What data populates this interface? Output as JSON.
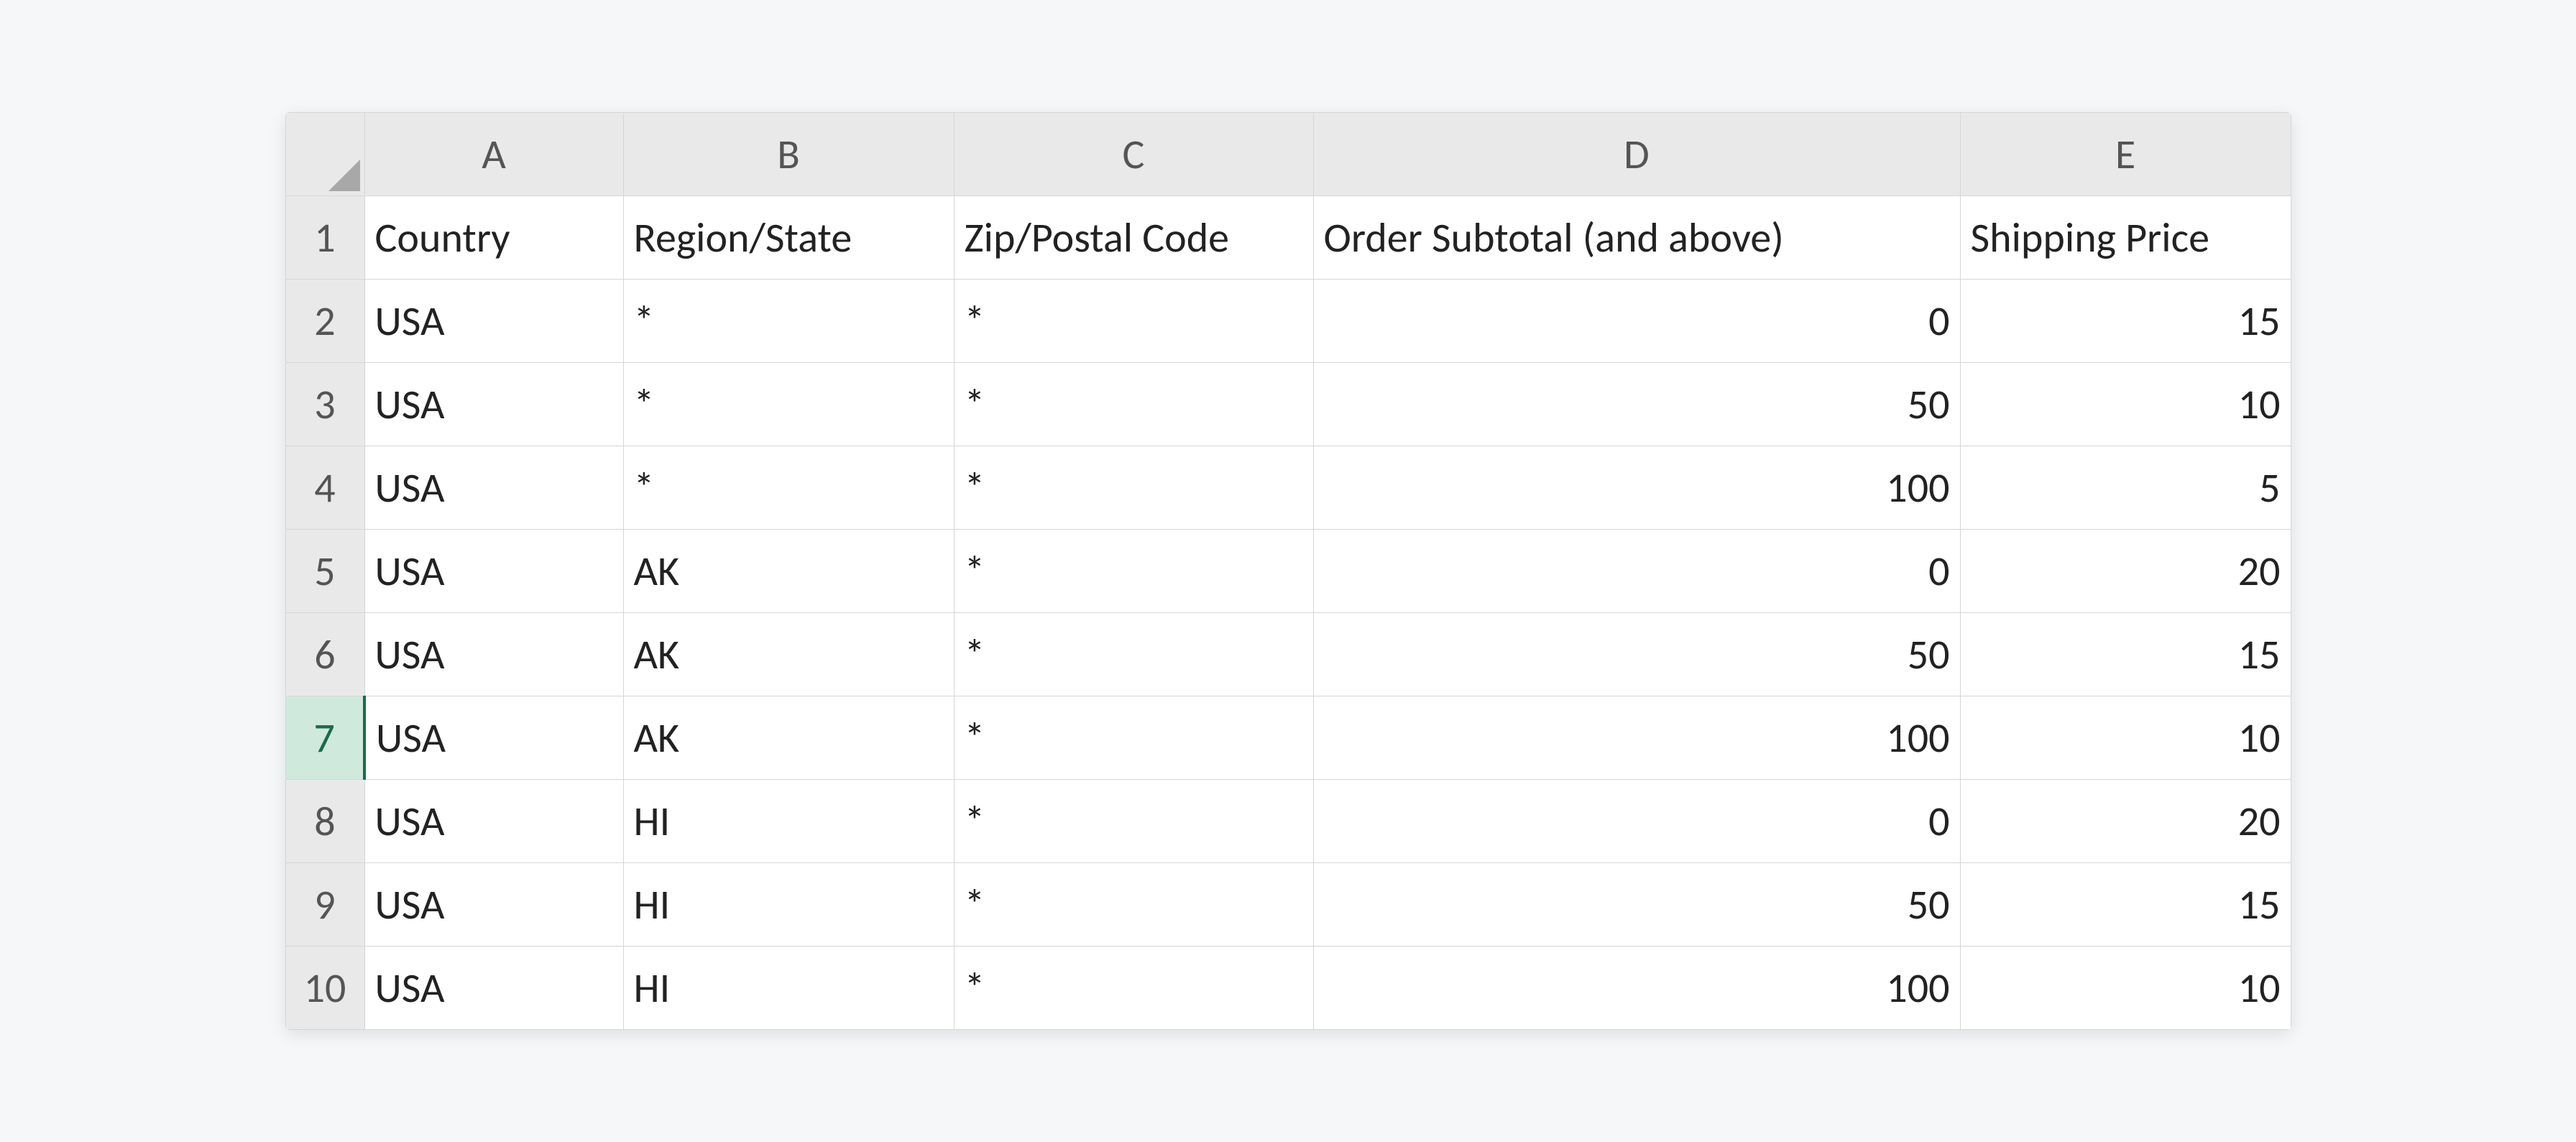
{
  "columns": [
    "A",
    "B",
    "C",
    "D",
    "E"
  ],
  "row_numbers": [
    "1",
    "2",
    "3",
    "4",
    "5",
    "6",
    "7",
    "8",
    "9",
    "10"
  ],
  "selected_row_index": 6,
  "headers": {
    "A": "Country",
    "B": "Region/State",
    "C": "Zip/Postal Code",
    "D": "Order Subtotal (and above)",
    "E": "Shipping Price"
  },
  "rows": [
    {
      "A": "USA",
      "B": "*",
      "C": "*",
      "D": "0",
      "E": "15"
    },
    {
      "A": "USA",
      "B": "*",
      "C": "*",
      "D": "50",
      "E": "10"
    },
    {
      "A": "USA",
      "B": "*",
      "C": "*",
      "D": "100",
      "E": "5"
    },
    {
      "A": "USA",
      "B": "AK",
      "C": "*",
      "D": "0",
      "E": "20"
    },
    {
      "A": "USA",
      "B": "AK",
      "C": "*",
      "D": "50",
      "E": "15"
    },
    {
      "A": "USA",
      "B": "AK",
      "C": "*",
      "D": "100",
      "E": "10"
    },
    {
      "A": "USA",
      "B": "HI",
      "C": "*",
      "D": "0",
      "E": "20"
    },
    {
      "A": "USA",
      "B": "HI",
      "C": "*",
      "D": "50",
      "E": "15"
    },
    {
      "A": "USA",
      "B": "HI",
      "C": "*",
      "D": "100",
      "E": "10"
    }
  ]
}
